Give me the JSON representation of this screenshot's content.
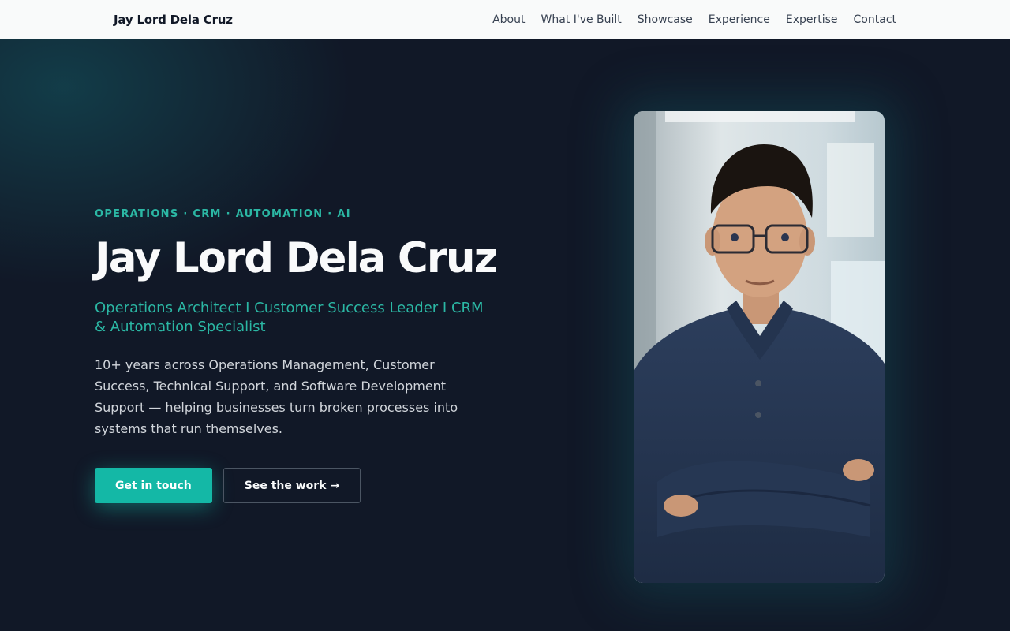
{
  "brand": {
    "name": "Jay Lord Dela Cruz"
  },
  "nav": {
    "links": [
      "About",
      "What I've Built",
      "Showcase",
      "Experience",
      "Expertise",
      "Contact"
    ]
  },
  "hero": {
    "eyebrow": "OPERATIONS · CRM · AUTOMATION · AI",
    "title": "Jay Lord Dela Cruz",
    "tagline": "Operations Architect I Customer Success Leader I CRM & Automation Specialist",
    "description": "10+ years across Operations Management, Customer Success, Technical Support, and Software Development Support — helping businesses turn broken processes into systems that run themselves.",
    "primary_cta": "Get in touch",
    "secondary_cta": "See the work →"
  },
  "colors": {
    "accent": "#14b8a6",
    "accent_text": "#2bb7a4",
    "background": "#111827",
    "navbar": "#f9fafa"
  }
}
